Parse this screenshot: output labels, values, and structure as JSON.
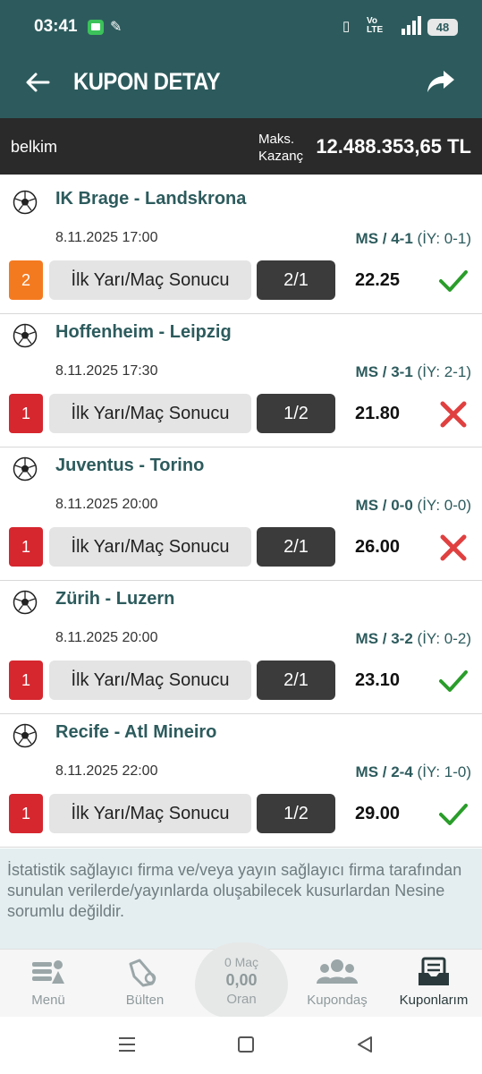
{
  "status_bar": {
    "time": "03:41",
    "battery": "48",
    "network": "4.56"
  },
  "header": {
    "title": "KUPON DETAY"
  },
  "summary": {
    "name": "belkim",
    "max_label_1": "Maks.",
    "max_label_2": "Kazanç",
    "max_amount": "12.488.353,65 TL"
  },
  "matches": [
    {
      "teams": "IK Brage - Landskrona",
      "date": "8.11.2025 17:00",
      "score_ms": "MS / 4-1",
      "score_iy": "(İY: 0-1)",
      "pos": "2",
      "pos_color": "#f47a20",
      "market": "İlk Yarı/Maç Sonucu",
      "pick": "2/1",
      "odds": "22.25",
      "result": "won"
    },
    {
      "teams": "Hoffenheim - Leipzig",
      "date": "8.11.2025 17:30",
      "score_ms": "MS / 3-1",
      "score_iy": "(İY: 2-1)",
      "pos": "1",
      "pos_color": "#d6262e",
      "market": "İlk Yarı/Maç Sonucu",
      "pick": "1/2",
      "odds": "21.80",
      "result": "lost"
    },
    {
      "teams": "Juventus - Torino",
      "date": "8.11.2025 20:00",
      "score_ms": "MS / 0-0",
      "score_iy": "(İY: 0-0)",
      "pos": "1",
      "pos_color": "#d6262e",
      "market": "İlk Yarı/Maç Sonucu",
      "pick": "2/1",
      "odds": "26.00",
      "result": "lost"
    },
    {
      "teams": "Zürih - Luzern",
      "date": "8.11.2025 20:00",
      "score_ms": "MS / 3-2",
      "score_iy": "(İY: 0-2)",
      "pos": "1",
      "pos_color": "#d6262e",
      "market": "İlk Yarı/Maç Sonucu",
      "pick": "2/1",
      "odds": "23.10",
      "result": "won"
    },
    {
      "teams": "Recife - Atl Mineiro",
      "date": "8.11.2025 22:00",
      "score_ms": "MS / 2-4",
      "score_iy": "(İY: 1-0)",
      "pos": "1",
      "pos_color": "#d6262e",
      "market": "İlk Yarı/Maç Sonucu",
      "pick": "1/2",
      "odds": "29.00",
      "result": "won"
    }
  ],
  "disclaimer": "İstatistik sağlayıcı firma ve/veya yayın sağlayıcı firma tarafından sunulan verilerde/yayınlarda oluşabilecek kusurlardan Nesine sorumlu değildir.",
  "bottom_nav": {
    "menu": "Menü",
    "bulten": "Bülten",
    "center_matches": "0 Maç",
    "center_amount": "0,00",
    "center_label": "Oran",
    "kupondas": "Kupondaş",
    "kuponlarim": "Kuponlarım"
  },
  "colors": {
    "primary": "#2d5b5d",
    "won": "#2a9d2a",
    "lost": "#e04040"
  }
}
